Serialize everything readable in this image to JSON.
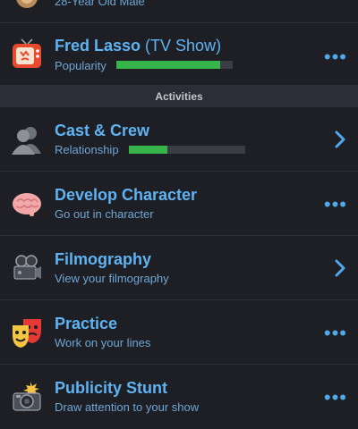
{
  "top_row": {
    "subtitle": "28-Year Old Male"
  },
  "show": {
    "title": "Fred Lasso",
    "title_suffix": "(TV Show)",
    "bar_label": "Popularity",
    "popularity": 0.89
  },
  "section_header": "Activities",
  "activities": [
    {
      "title": "Cast & Crew",
      "subtitle": "Relationship",
      "relationship": 0.33,
      "action": "chevron"
    },
    {
      "title": "Develop Character",
      "subtitle": "Go out in character",
      "action": "more"
    },
    {
      "title": "Filmography",
      "subtitle": "View your filmography",
      "action": "chevron"
    },
    {
      "title": "Practice",
      "subtitle": "Work on your lines",
      "action": "more"
    },
    {
      "title": "Publicity Stunt",
      "subtitle": "Draw attention to your show",
      "action": "more"
    }
  ],
  "more_glyph": "•••",
  "colors": {
    "accent": "#5fb3f2",
    "bar_fill": "#38b54a",
    "background": "#1e1f24"
  }
}
